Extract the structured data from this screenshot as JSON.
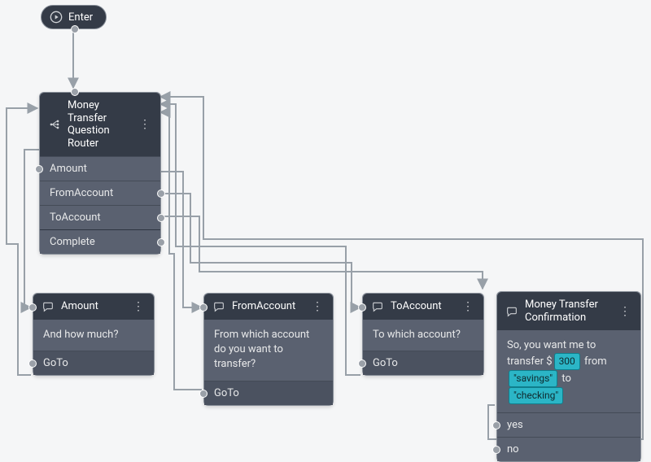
{
  "enter": {
    "label": "Enter"
  },
  "router": {
    "title": "Money Transfer Question Router",
    "items": [
      "Amount",
      "FromAccount",
      "ToAccount",
      "Complete"
    ]
  },
  "amountNode": {
    "title": "Amount",
    "body": "And how much?",
    "goto": "GoTo"
  },
  "fromNode": {
    "title": "FromAccount",
    "body": "From which account do you want to transfer?",
    "goto": "GoTo"
  },
  "toNode": {
    "title": "ToAccount",
    "body": "To which account?",
    "goto": "GoTo"
  },
  "confirmNode": {
    "title": "Money Transfer Confirmation",
    "body_prefix": "So, you want me to transfer $",
    "amount": "300",
    "mid1": "from",
    "from": "\"savings\"",
    "mid2": "to",
    "to": "\"checking\"",
    "yes": "yes",
    "no": "no"
  }
}
